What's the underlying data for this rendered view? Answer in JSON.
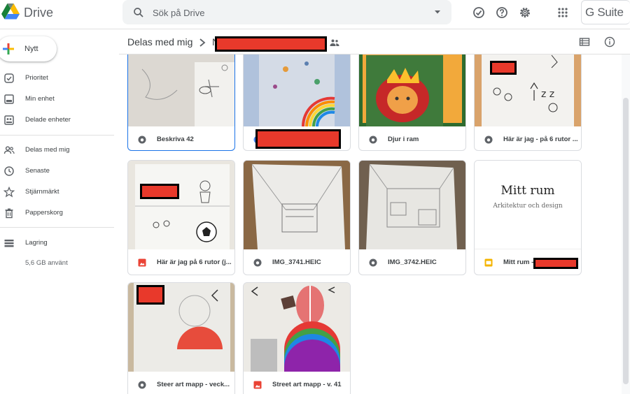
{
  "app": {
    "name": "Drive",
    "suite_label": "G Suite"
  },
  "search": {
    "placeholder": "Sök på Drive"
  },
  "sidebar": {
    "new_label": "Nytt",
    "items": [
      {
        "label": "Prioritet",
        "icon": "checkmark-circle-icon"
      },
      {
        "label": "Min enhet",
        "icon": "drive-icon"
      },
      {
        "label": "Delade enheter",
        "icon": "shared-drives-icon"
      },
      {
        "label": "Delas med mig",
        "icon": "people-icon"
      },
      {
        "label": "Senaste",
        "icon": "clock-icon"
      },
      {
        "label": "Stjärnmärkt",
        "icon": "star-icon"
      },
      {
        "label": "Papperskorg",
        "icon": "trash-icon"
      },
      {
        "label": "Lagring",
        "icon": "storage-icon"
      }
    ],
    "storage_used": "5,6 GB använt"
  },
  "breadcrumb": {
    "root": "Delas med mig",
    "current_initial": "N"
  },
  "files": [
    {
      "name": "Beskriva 42",
      "type": "image",
      "selected": true
    },
    {
      "name": "",
      "type": "image",
      "redacted": true
    },
    {
      "name": "Djur i ram",
      "type": "image"
    },
    {
      "name": "Här är jag - på 6 rutor ...",
      "type": "image"
    },
    {
      "name": "Här är jag på 6 rutor (j...",
      "type": "photo"
    },
    {
      "name": "IMG_3741.HEIC",
      "type": "image"
    },
    {
      "name": "IMG_3742.HEIC",
      "type": "image"
    },
    {
      "name": "Mitt rum -",
      "type": "slides"
    },
    {
      "name": "Steer art mapp - veck...",
      "type": "image"
    },
    {
      "name": "Street art mapp - v. 41",
      "type": "photo"
    }
  ],
  "slide_preview": {
    "title": "Mitt rum",
    "subtitle": "Arkitektur och design"
  },
  "colors": {
    "accent_blue": "#1a73e8",
    "redaction": "#e8392b",
    "photo_icon": "#ea4335",
    "slides_icon": "#f4b400"
  }
}
